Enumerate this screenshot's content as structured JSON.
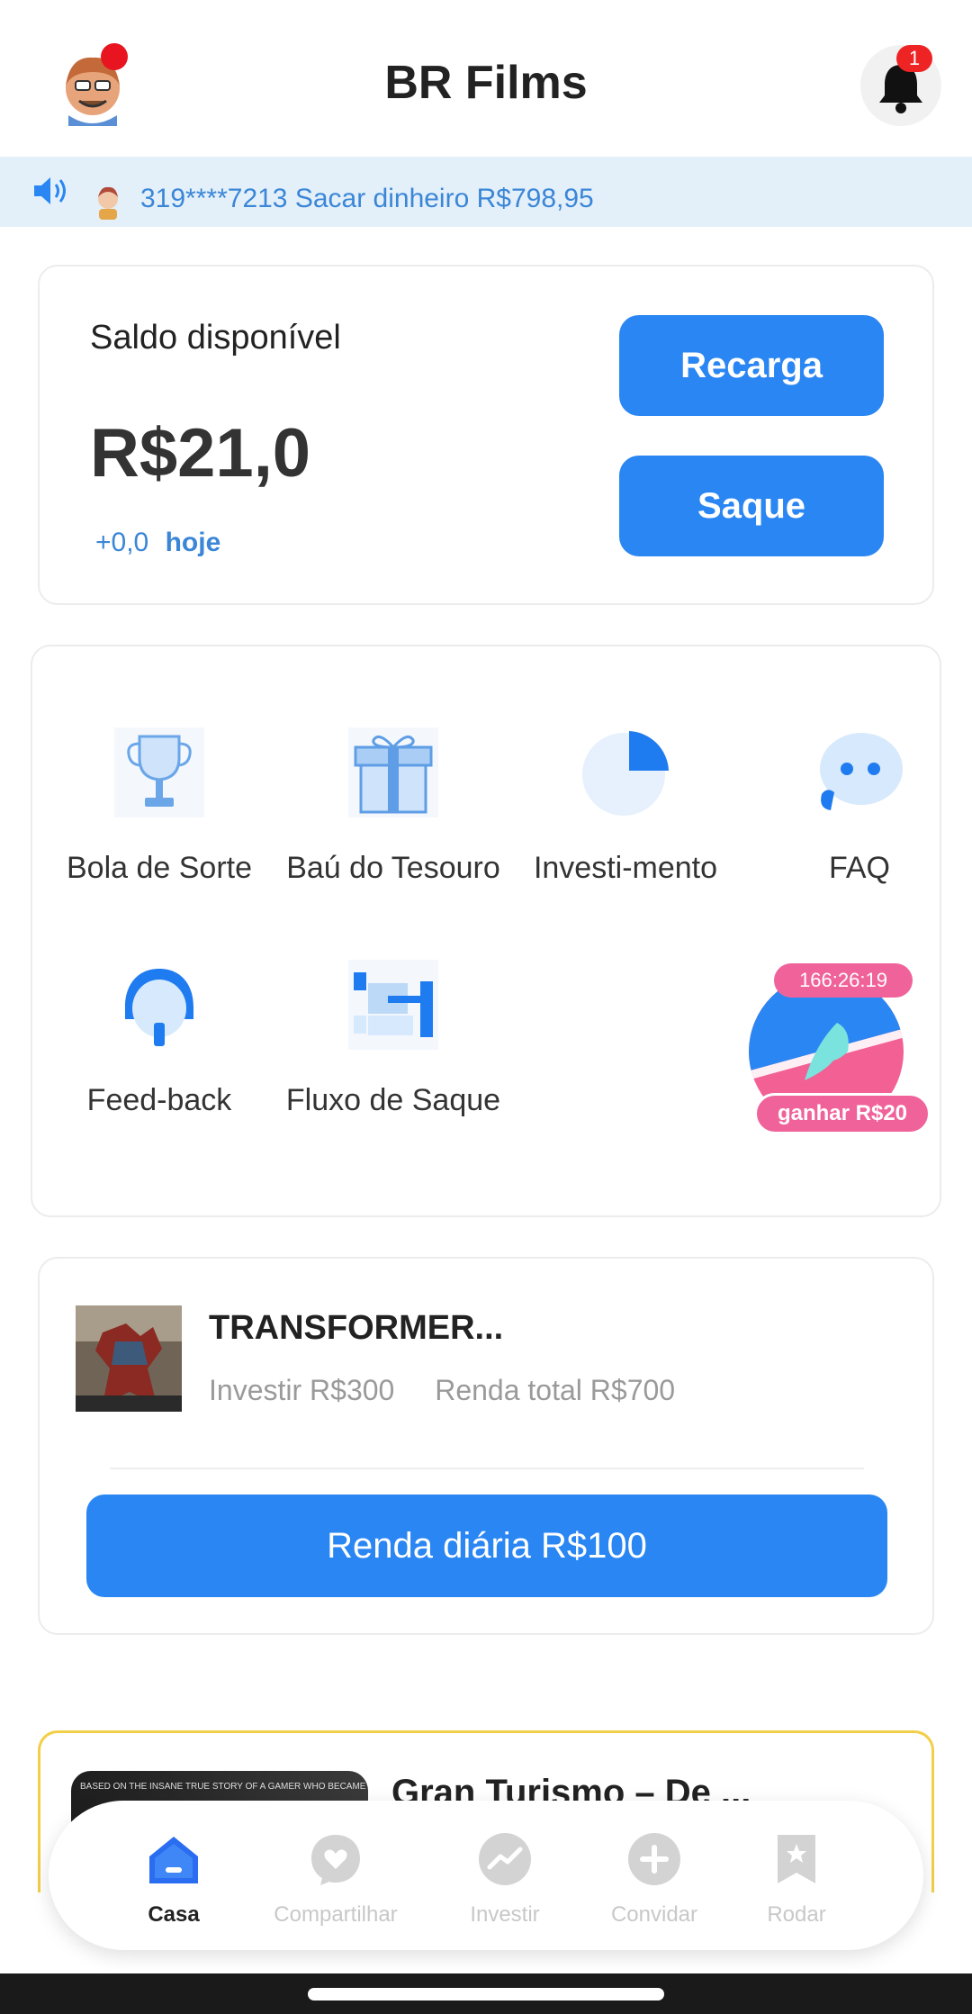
{
  "header": {
    "title": "BR Films",
    "notification_count": "1"
  },
  "marquee": {
    "text": "319****7213 Sacar dinheiro R$798,95"
  },
  "balance": {
    "label": "Saldo disponível",
    "amount": "R$21,0",
    "today_value": "+0,0",
    "today_label": "hoje",
    "recharge_label": "Recarga",
    "withdraw_label": "Saque"
  },
  "menu": {
    "items": [
      {
        "label": "Bola de Sorte",
        "icon": "trophy-icon"
      },
      {
        "label": "Baú do Tesouro",
        "icon": "gift-icon"
      },
      {
        "label": "Investi-mento",
        "icon": "pie-chart-icon"
      },
      {
        "label": "FAQ",
        "icon": "chat-bubble-icon"
      },
      {
        "label": "Feed-back",
        "icon": "headset-icon"
      },
      {
        "label": "Fluxo de Saque",
        "icon": "flow-icon"
      }
    ],
    "spin": {
      "timer": "166:26:19",
      "earn_label": "ganhar R$20"
    }
  },
  "product": {
    "title": "TRANSFORMER...",
    "invest": "Investir R$300",
    "total_income": "Renda total R$700",
    "daily_button": "Renda diária R$100"
  },
  "product2": {
    "title": "Gran Turismo – De ...",
    "poster_text": "BASED ON THE INSANE TRUE STORY OF A GAMER WHO BECAME A RACER"
  },
  "bottom_nav": {
    "items": [
      {
        "label": "Casa",
        "icon": "home-icon",
        "active": true
      },
      {
        "label": "Compartilhar",
        "icon": "heart-chat-icon",
        "active": false
      },
      {
        "label": "Investir",
        "icon": "trend-icon",
        "active": false
      },
      {
        "label": "Convidar",
        "icon": "plus-icon",
        "active": false
      },
      {
        "label": "Rodar",
        "icon": "bookmark-star-icon",
        "active": false
      }
    ]
  },
  "colors": {
    "primary": "#2a86f2",
    "marquee_bg": "#e3f0fa",
    "badge_pink": "#f0639a",
    "notification_red": "#ee2424",
    "highlight_border": "#f2cf48"
  }
}
